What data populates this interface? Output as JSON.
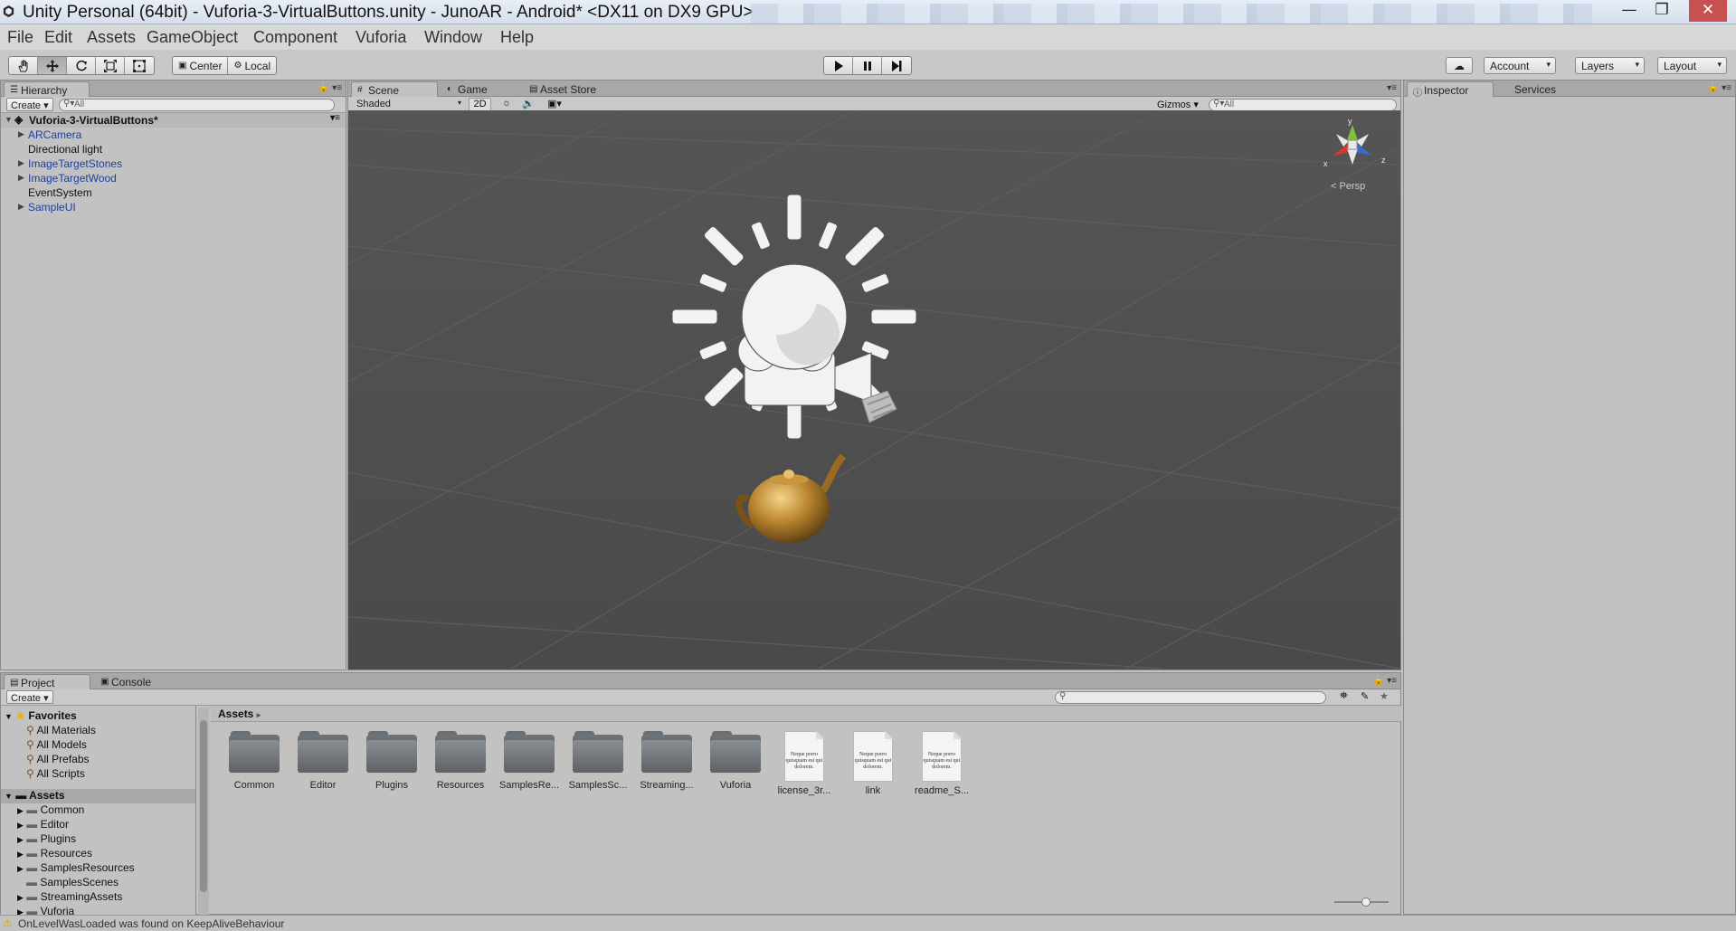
{
  "window": {
    "title": "Unity Personal (64bit) - Vuforia-3-VirtualButtons.unity - JunoAR - Android* <DX11 on DX9 GPU>",
    "minimize": "—",
    "maximize": "❐",
    "close": "✕"
  },
  "menu": [
    "File",
    "Edit",
    "Assets",
    "GameObject",
    "Component",
    "Vuforia",
    "Window",
    "Help"
  ],
  "toolbar": {
    "tools": [
      "hand-tool",
      "move-tool",
      "rotate-tool",
      "scale-tool",
      "rect-tool"
    ],
    "pivot": "Center",
    "space": "Local",
    "account": "Account",
    "layers": "Layers",
    "layout": "Layout"
  },
  "hierarchy": {
    "tab": "Hierarchy",
    "create": "Create",
    "search_placeholder": "All",
    "scene_name": "Vuforia-3-VirtualButtons*",
    "items": [
      {
        "label": "ARCamera",
        "expandable": true,
        "prefab": true
      },
      {
        "label": "Directional light",
        "expandable": false,
        "prefab": false
      },
      {
        "label": "ImageTargetStones",
        "expandable": true,
        "prefab": true
      },
      {
        "label": "ImageTargetWood",
        "expandable": true,
        "prefab": true
      },
      {
        "label": "EventSystem",
        "expandable": false,
        "prefab": false
      },
      {
        "label": "SampleUI",
        "expandable": true,
        "prefab": true
      }
    ]
  },
  "scene_view": {
    "tabs": [
      "Scene",
      "Game",
      "Asset Store"
    ],
    "shading": "Shaded",
    "mode_2d": "2D",
    "gizmos": "Gizmos",
    "search_placeholder": "All",
    "persp": "Persp",
    "axes": {
      "x": "x",
      "y": "y",
      "z": "z"
    }
  },
  "inspector": {
    "tabs": [
      "Inspector",
      "Services"
    ]
  },
  "project": {
    "tabs": [
      "Project",
      "Console"
    ],
    "create": "Create",
    "favorites_label": "Favorites",
    "favorites": [
      "All Materials",
      "All Models",
      "All Prefabs",
      "All Scripts"
    ],
    "assets_label": "Assets",
    "asset_tree": [
      "Common",
      "Editor",
      "Plugins",
      "Resources",
      "SamplesResources",
      "SamplesScenes",
      "StreamingAssets",
      "Vuforia"
    ],
    "breadcrumb": "Assets",
    "grid": [
      {
        "label": "Common",
        "kind": "folder"
      },
      {
        "label": "Editor",
        "kind": "folder"
      },
      {
        "label": "Plugins",
        "kind": "folder"
      },
      {
        "label": "Resources",
        "kind": "folder"
      },
      {
        "label": "SamplesRe...",
        "kind": "folder"
      },
      {
        "label": "SamplesSc...",
        "kind": "folder"
      },
      {
        "label": "Streaming...",
        "kind": "folder"
      },
      {
        "label": "Vuforia",
        "kind": "folder"
      },
      {
        "label": "license_3r...",
        "kind": "text"
      },
      {
        "label": "link",
        "kind": "text"
      },
      {
        "label": "readme_S...",
        "kind": "text"
      }
    ],
    "doc_preview_text": "Neque porro quisquam est qui dolorem."
  },
  "status_bar": {
    "message": "OnLevelWasLoaded was found on KeepAliveBehaviour"
  },
  "colors": {
    "prefab_blue": "#1f3f9c",
    "scene_bg": "#4f4f4f",
    "panel_bg": "#c2c2c2"
  }
}
